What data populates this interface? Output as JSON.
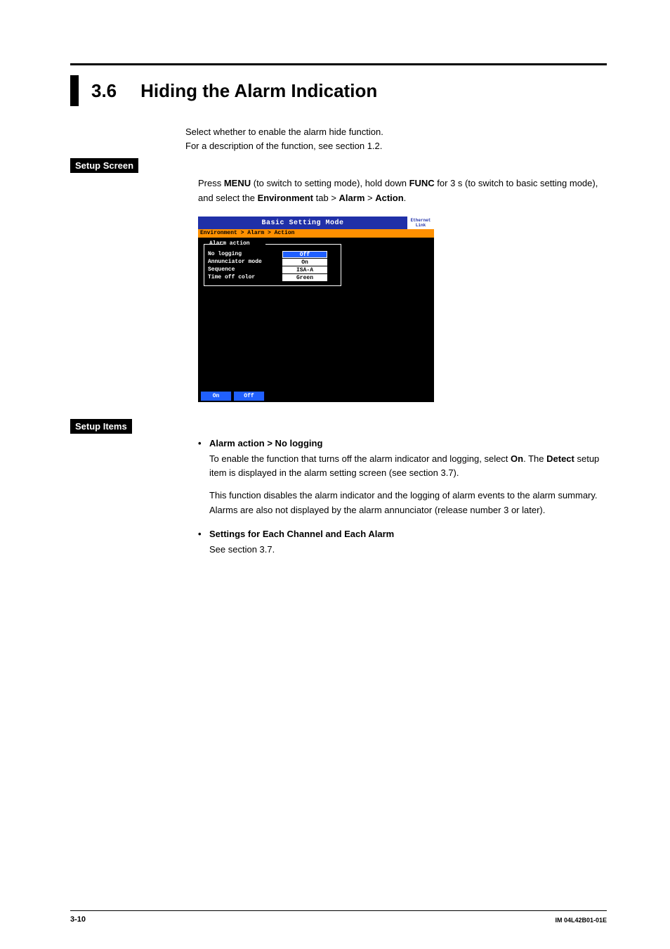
{
  "heading": {
    "number": "3.6",
    "title": "Hiding the Alarm Indication"
  },
  "intro": {
    "line1": "Select whether to enable the alarm hide function.",
    "line2": "For a description of the function, see section 1.2."
  },
  "labels": {
    "setup_screen": "Setup Screen",
    "setup_items": "Setup Items"
  },
  "setup_instr": {
    "pre_menu": "Press ",
    "menu": "MENU",
    "mid1": " (to switch to setting mode), hold down ",
    "func": "FUNC",
    "mid2": " for 3 s (to switch to basic setting mode), and select the ",
    "env": "Environment",
    "gt1": " tab > ",
    "alarm": "Alarm",
    "gt2": " > ",
    "action": "Action",
    "period": "."
  },
  "device": {
    "title": "Basic Setting Mode",
    "badge1": "Ethernet",
    "badge2": "Link",
    "breadcrumb": "Environment > Alarm > Action",
    "legend": "Alarm action",
    "rows": [
      {
        "label": "No logging",
        "value": "Off",
        "selected": true
      },
      {
        "label": "Annunciator mode",
        "value": "On",
        "selected": false
      },
      {
        "label": "Sequence",
        "value": "ISA-A",
        "selected": false
      },
      {
        "label": "Time off color",
        "value": "Green",
        "selected": false
      }
    ],
    "soft": {
      "on": "On",
      "off": "Off"
    }
  },
  "items": {
    "bullet": "•",
    "i1": {
      "head": "Alarm action > No logging",
      "p1a": "To enable the function that turns off the alarm indicator and logging, select ",
      "p1on": "On",
      "p1b": ". The ",
      "p1det": "Detect",
      "p1c": " setup item is displayed in the alarm setting screen (see section 3.7).",
      "p2": "This function disables the alarm indicator and the logging of alarm events to the alarm summary. Alarms are also not displayed by the alarm annunciator (release number 3 or later)."
    },
    "i2": {
      "head": "Settings for Each Channel and Each Alarm",
      "p1": "See section 3.7."
    }
  },
  "footer": {
    "page": "3-10",
    "doc": "IM 04L42B01-01E"
  }
}
